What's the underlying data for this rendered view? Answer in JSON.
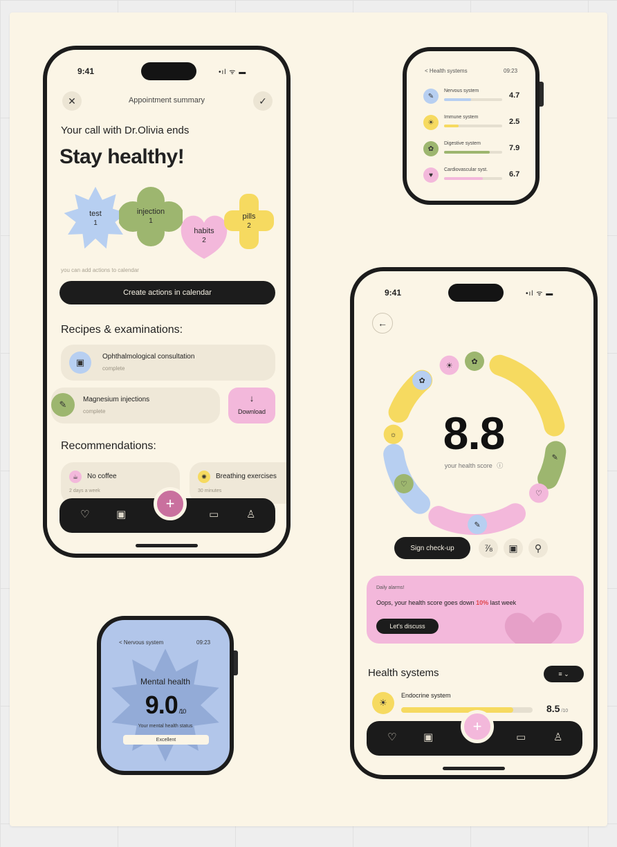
{
  "phone_left": {
    "status": {
      "time": "9:41",
      "icons": "•ıl ᯤ ▬"
    },
    "header_title": "Appointment summary",
    "close_icon": "✕",
    "check_icon": "✓",
    "subtitle": "Your call with Dr.Olivia ends",
    "headline": "Stay healthy!",
    "shapes": [
      {
        "label": "test",
        "count": "1",
        "color": "#b7cff1"
      },
      {
        "label": "injection",
        "count": "1",
        "color": "#9db66f"
      },
      {
        "label": "habits",
        "count": "2",
        "color": "#f3b8db"
      },
      {
        "label": "pills",
        "count": "2",
        "color": "#f6da60"
      }
    ],
    "hint": "you can add actions to calendar",
    "cta": "Create actions in calendar",
    "section1": "Recipes & examinations:",
    "items": [
      {
        "title": "Ophthalmological consultation",
        "sub": "complete",
        "color": "#b7cff1",
        "icon": "▣"
      },
      {
        "title": "Magnesium injections",
        "sub": "complete",
        "color": "#9db66f",
        "icon": "✎"
      }
    ],
    "download": {
      "icon": "↓",
      "label": "Download",
      "color": "#f3b8db"
    },
    "section2": "Recommendations:",
    "recs": [
      {
        "title": "No coffee",
        "sub": "2 days a week",
        "color": "#f3b8db",
        "icon": "☕"
      },
      {
        "title": "Breathing exercises",
        "sub": "30 minutes",
        "color": "#f6da60",
        "icon": "✺"
      }
    ],
    "tabbar": {
      "fab_icon": "+",
      "fab_color": "#c9709e",
      "icons": [
        "♡",
        "▣",
        "▭",
        "♙"
      ]
    }
  },
  "watch_top": {
    "back": "< Health systems",
    "time": "09:23",
    "rows": [
      {
        "name": "Nervous system",
        "value": "4.7",
        "color": "#b7cff1",
        "fill": 0.47,
        "icon": "✎"
      },
      {
        "name": "Immune system",
        "value": "2.5",
        "color": "#f6da60",
        "fill": 0.25,
        "icon": "☀"
      },
      {
        "name": "Digestive system",
        "value": "7.9",
        "color": "#9db66f",
        "fill": 0.79,
        "icon": "✿"
      },
      {
        "name": "Cardiovascular syst.",
        "value": "6.7",
        "color": "#f3b8db",
        "fill": 0.67,
        "icon": "♥"
      }
    ]
  },
  "phone_right": {
    "status": {
      "time": "9:41",
      "icons": "•ıl ᯤ ▬"
    },
    "back_icon": "←",
    "score": "8.8",
    "score_label": "your health score",
    "info_icon": "ⓘ",
    "ring_icons": [
      "✿",
      "✎",
      "♡",
      "✎",
      "♡",
      "☼",
      "✿",
      "☀"
    ],
    "sign_btn": "Sign check-up",
    "actions": [
      "⅞",
      "▣",
      "⚲"
    ],
    "alert": {
      "kicker": "Daily alarms!",
      "text_pre": "Oops, your health score goes down ",
      "text_hl": "10%",
      "text_post": " last week",
      "button": "Let's discuss",
      "color": "#f3b8db",
      "hl_color": "#e0454c"
    },
    "systems_title": "Health systems",
    "systems_toggle": "≡  ⌄",
    "system_row": {
      "name": "Endocrine system",
      "value": "8.5",
      "unit": "/10",
      "color": "#f6da60",
      "fill": 0.85,
      "icon": "☀"
    },
    "tabbar": {
      "fab_icon": "+",
      "fab_color": "#f3b8db",
      "icons": [
        "♡",
        "▣",
        "▭",
        "♙"
      ]
    }
  },
  "watch_bottom": {
    "back": "< Nervous system",
    "time": "09:23",
    "title": "Mental health",
    "value": "9.0",
    "unit": "/10",
    "caption": "Your mental health status",
    "badge": "Excellent",
    "bg": "#b2c6ea",
    "star": "#93abd7"
  }
}
